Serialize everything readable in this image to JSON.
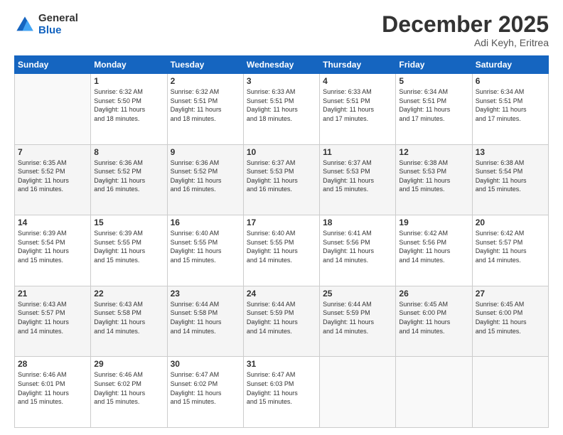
{
  "header": {
    "logo_general": "General",
    "logo_blue": "Blue",
    "month": "December 2025",
    "location": "Adi Keyh, Eritrea"
  },
  "weekdays": [
    "Sunday",
    "Monday",
    "Tuesday",
    "Wednesday",
    "Thursday",
    "Friday",
    "Saturday"
  ],
  "weeks": [
    [
      {
        "day": "",
        "info": ""
      },
      {
        "day": "1",
        "info": "Sunrise: 6:32 AM\nSunset: 5:50 PM\nDaylight: 11 hours\nand 18 minutes."
      },
      {
        "day": "2",
        "info": "Sunrise: 6:32 AM\nSunset: 5:51 PM\nDaylight: 11 hours\nand 18 minutes."
      },
      {
        "day": "3",
        "info": "Sunrise: 6:33 AM\nSunset: 5:51 PM\nDaylight: 11 hours\nand 18 minutes."
      },
      {
        "day": "4",
        "info": "Sunrise: 6:33 AM\nSunset: 5:51 PM\nDaylight: 11 hours\nand 17 minutes."
      },
      {
        "day": "5",
        "info": "Sunrise: 6:34 AM\nSunset: 5:51 PM\nDaylight: 11 hours\nand 17 minutes."
      },
      {
        "day": "6",
        "info": "Sunrise: 6:34 AM\nSunset: 5:51 PM\nDaylight: 11 hours\nand 17 minutes."
      }
    ],
    [
      {
        "day": "7",
        "info": "Sunrise: 6:35 AM\nSunset: 5:52 PM\nDaylight: 11 hours\nand 16 minutes."
      },
      {
        "day": "8",
        "info": "Sunrise: 6:36 AM\nSunset: 5:52 PM\nDaylight: 11 hours\nand 16 minutes."
      },
      {
        "day": "9",
        "info": "Sunrise: 6:36 AM\nSunset: 5:52 PM\nDaylight: 11 hours\nand 16 minutes."
      },
      {
        "day": "10",
        "info": "Sunrise: 6:37 AM\nSunset: 5:53 PM\nDaylight: 11 hours\nand 16 minutes."
      },
      {
        "day": "11",
        "info": "Sunrise: 6:37 AM\nSunset: 5:53 PM\nDaylight: 11 hours\nand 15 minutes."
      },
      {
        "day": "12",
        "info": "Sunrise: 6:38 AM\nSunset: 5:53 PM\nDaylight: 11 hours\nand 15 minutes."
      },
      {
        "day": "13",
        "info": "Sunrise: 6:38 AM\nSunset: 5:54 PM\nDaylight: 11 hours\nand 15 minutes."
      }
    ],
    [
      {
        "day": "14",
        "info": "Sunrise: 6:39 AM\nSunset: 5:54 PM\nDaylight: 11 hours\nand 15 minutes."
      },
      {
        "day": "15",
        "info": "Sunrise: 6:39 AM\nSunset: 5:55 PM\nDaylight: 11 hours\nand 15 minutes."
      },
      {
        "day": "16",
        "info": "Sunrise: 6:40 AM\nSunset: 5:55 PM\nDaylight: 11 hours\nand 15 minutes."
      },
      {
        "day": "17",
        "info": "Sunrise: 6:40 AM\nSunset: 5:55 PM\nDaylight: 11 hours\nand 14 minutes."
      },
      {
        "day": "18",
        "info": "Sunrise: 6:41 AM\nSunset: 5:56 PM\nDaylight: 11 hours\nand 14 minutes."
      },
      {
        "day": "19",
        "info": "Sunrise: 6:42 AM\nSunset: 5:56 PM\nDaylight: 11 hours\nand 14 minutes."
      },
      {
        "day": "20",
        "info": "Sunrise: 6:42 AM\nSunset: 5:57 PM\nDaylight: 11 hours\nand 14 minutes."
      }
    ],
    [
      {
        "day": "21",
        "info": "Sunrise: 6:43 AM\nSunset: 5:57 PM\nDaylight: 11 hours\nand 14 minutes."
      },
      {
        "day": "22",
        "info": "Sunrise: 6:43 AM\nSunset: 5:58 PM\nDaylight: 11 hours\nand 14 minutes."
      },
      {
        "day": "23",
        "info": "Sunrise: 6:44 AM\nSunset: 5:58 PM\nDaylight: 11 hours\nand 14 minutes."
      },
      {
        "day": "24",
        "info": "Sunrise: 6:44 AM\nSunset: 5:59 PM\nDaylight: 11 hours\nand 14 minutes."
      },
      {
        "day": "25",
        "info": "Sunrise: 6:44 AM\nSunset: 5:59 PM\nDaylight: 11 hours\nand 14 minutes."
      },
      {
        "day": "26",
        "info": "Sunrise: 6:45 AM\nSunset: 6:00 PM\nDaylight: 11 hours\nand 14 minutes."
      },
      {
        "day": "27",
        "info": "Sunrise: 6:45 AM\nSunset: 6:00 PM\nDaylight: 11 hours\nand 15 minutes."
      }
    ],
    [
      {
        "day": "28",
        "info": "Sunrise: 6:46 AM\nSunset: 6:01 PM\nDaylight: 11 hours\nand 15 minutes."
      },
      {
        "day": "29",
        "info": "Sunrise: 6:46 AM\nSunset: 6:02 PM\nDaylight: 11 hours\nand 15 minutes."
      },
      {
        "day": "30",
        "info": "Sunrise: 6:47 AM\nSunset: 6:02 PM\nDaylight: 11 hours\nand 15 minutes."
      },
      {
        "day": "31",
        "info": "Sunrise: 6:47 AM\nSunset: 6:03 PM\nDaylight: 11 hours\nand 15 minutes."
      },
      {
        "day": "",
        "info": ""
      },
      {
        "day": "",
        "info": ""
      },
      {
        "day": "",
        "info": ""
      }
    ]
  ],
  "row_colors": [
    "white",
    "stripe",
    "white",
    "stripe",
    "white"
  ]
}
